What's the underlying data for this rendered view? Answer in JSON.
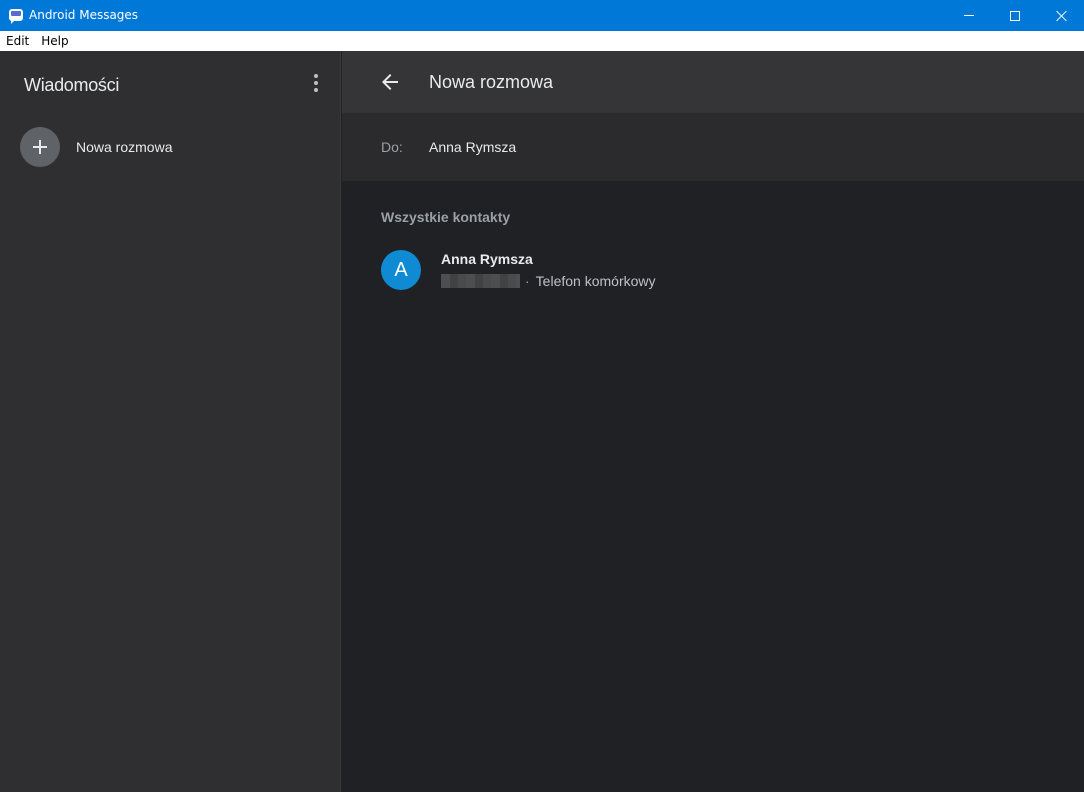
{
  "window": {
    "title": "Android Messages",
    "controls": {
      "minimize": "minimize",
      "maximize": "maximize",
      "close": "close"
    }
  },
  "menubar": {
    "items": [
      "Edit",
      "Help"
    ]
  },
  "sidebar": {
    "title": "Wiadomości",
    "new_conversation_label": "Nowa rozmowa"
  },
  "header": {
    "title": "Nowa rozmowa"
  },
  "recipient": {
    "to_label": "Do:",
    "value": "Anna Rymsza"
  },
  "contacts": {
    "section_label": "Wszystkie kontakty",
    "items": [
      {
        "avatar_letter": "A",
        "name": "Anna Rymsza",
        "separator": "·",
        "type": "Telefon komórkowy",
        "avatar_color": "#0f8bd3"
      }
    ]
  },
  "colors": {
    "titlebar": "#0078d7",
    "sidebar_bg": "#2f2f31",
    "main_bg": "#202124",
    "header_bg": "#353537"
  }
}
